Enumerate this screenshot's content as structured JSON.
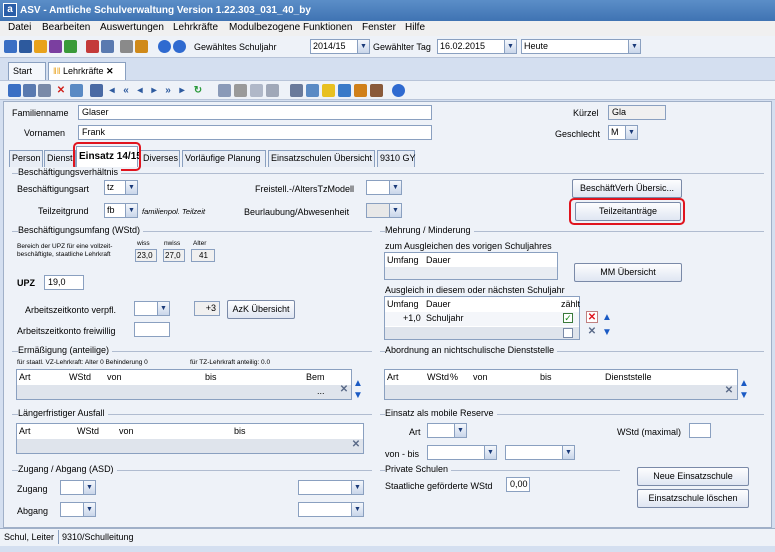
{
  "window": {
    "title": "ASV - Amtliche Schulverwaltung Version 1.22.303_031_40_by"
  },
  "menu": [
    "Datei",
    "Bearbeiten",
    "Auswertungen",
    "Lehrkräfte",
    "Modulbezogene Funktionen",
    "Fenster",
    "Hilfe"
  ],
  "toolbar": {
    "schuljahr_label": "Gewähltes Schuljahr",
    "schuljahr_value": "2014/15",
    "tag_label": "Gewählter Tag",
    "tag_value": "16.02.2015",
    "heute_value": "Heute"
  },
  "doc_tabs": [
    {
      "label": "Start"
    },
    {
      "label": "Lehrkräfte"
    }
  ],
  "person": {
    "familienname_label": "Familienname",
    "familienname": "Glaser",
    "vornamen_label": "Vornamen",
    "vornamen": "Frank",
    "kuerzel_label": "Kürzel",
    "kuerzel": "Gla",
    "geschlecht_label": "Geschlecht",
    "geschlecht": "M"
  },
  "tabs": [
    "Person",
    "Dienst",
    "Einsatz 14/15",
    "Diverses",
    "Vorläufige Planung",
    "Einsatzschulen Übersicht",
    "9310 GY"
  ],
  "beschaeftigung": {
    "section": "Beschäftigungsverhältnis",
    "art_label": "Beschäftigungsart",
    "art_value": "tz",
    "teilzeitgrund_label": "Teilzeitgrund",
    "teilzeitgrund_value": "fb",
    "teilzeitgrund_note": "familienpol. Teilzeit",
    "freistell_label": "Freistell.-/AltersTzModell",
    "beurlaubung_label": "Beurlaubung/Abwesenheit",
    "btn_uebersicht": "BeschäftVerh Übersic...",
    "btn_teilzeit": "Teilzeitanträge"
  },
  "umfang": {
    "section": "Beschäftigungsumfang (WStd)",
    "bereich_note": "Bereich der UPZ für eine vollzeit-beschäftigte, staatliche Lehrkraft",
    "wiss_label": "wiss",
    "wiss": "23,0",
    "nwiss_label": "nwiss",
    "nwiss": "27,0",
    "alter_label": "Alter",
    "alter": "41",
    "upz_label": "UPZ",
    "upz": "19,0",
    "azk_label": "Arbeitszeitkonto verpfl.",
    "azk_plus": "+3",
    "azk_btn": "AzK Übersicht",
    "azk_freiwillig_label": "Arbeitszeitkonto freiwillig"
  },
  "mehrung": {
    "section": "Mehrung / Minderung",
    "ausgleich_vorig": "zum Ausgleichen des vorigen Schuljahres",
    "col_umfang": "Umfang",
    "col_dauer": "Dauer",
    "mm_btn": "MM Übersicht",
    "ausgleich_naechst": "Ausgleich in diesem oder nächsten Schuljahr",
    "col_zaehlt": "zählt",
    "row_umfang": "+1,0",
    "row_dauer": "Schuljahr"
  },
  "ermaessigung": {
    "section": "Ermäßigung (anteilige)",
    "note1": "für staatl. VZ-Lehrkraft: Alter 0 Behinderung 0",
    "note2": "für TZ-Lehrkraft anteilig: 0.0",
    "cols": [
      "Art",
      "WStd",
      "von",
      "bis",
      "Bem"
    ],
    "dots": "..."
  },
  "abordnung": {
    "section": "Abordnung an nichtschulische Dienststelle",
    "cols": [
      "Art",
      "WStd",
      "%",
      "von",
      "bis",
      "Dienststelle"
    ]
  },
  "ausfall": {
    "section": "Längerfristiger Ausfall",
    "cols": [
      "Art",
      "WStd",
      "von",
      "bis"
    ]
  },
  "reserve": {
    "section": "Einsatz als mobile Reserve",
    "art_label": "Art",
    "wstd_label": "WStd (maximal)",
    "vonbis_label": "von - bis"
  },
  "zugang": {
    "section": "Zugang / Abgang (ASD)",
    "zugang_label": "Zugang",
    "abgang_label": "Abgang"
  },
  "private": {
    "section": "Private Schulen",
    "wstd_label": "Staatliche geförderte WStd",
    "wstd_value": "0,00",
    "btn_neu": "Neue Einsatzschule",
    "btn_loeschen": "Einsatzschule löschen"
  },
  "status": {
    "role": "Schul, Leiter",
    "school": "9310/Schulleitung"
  },
  "colors": {
    "accent": "#3f73b3",
    "highlight": "#e0141e"
  }
}
